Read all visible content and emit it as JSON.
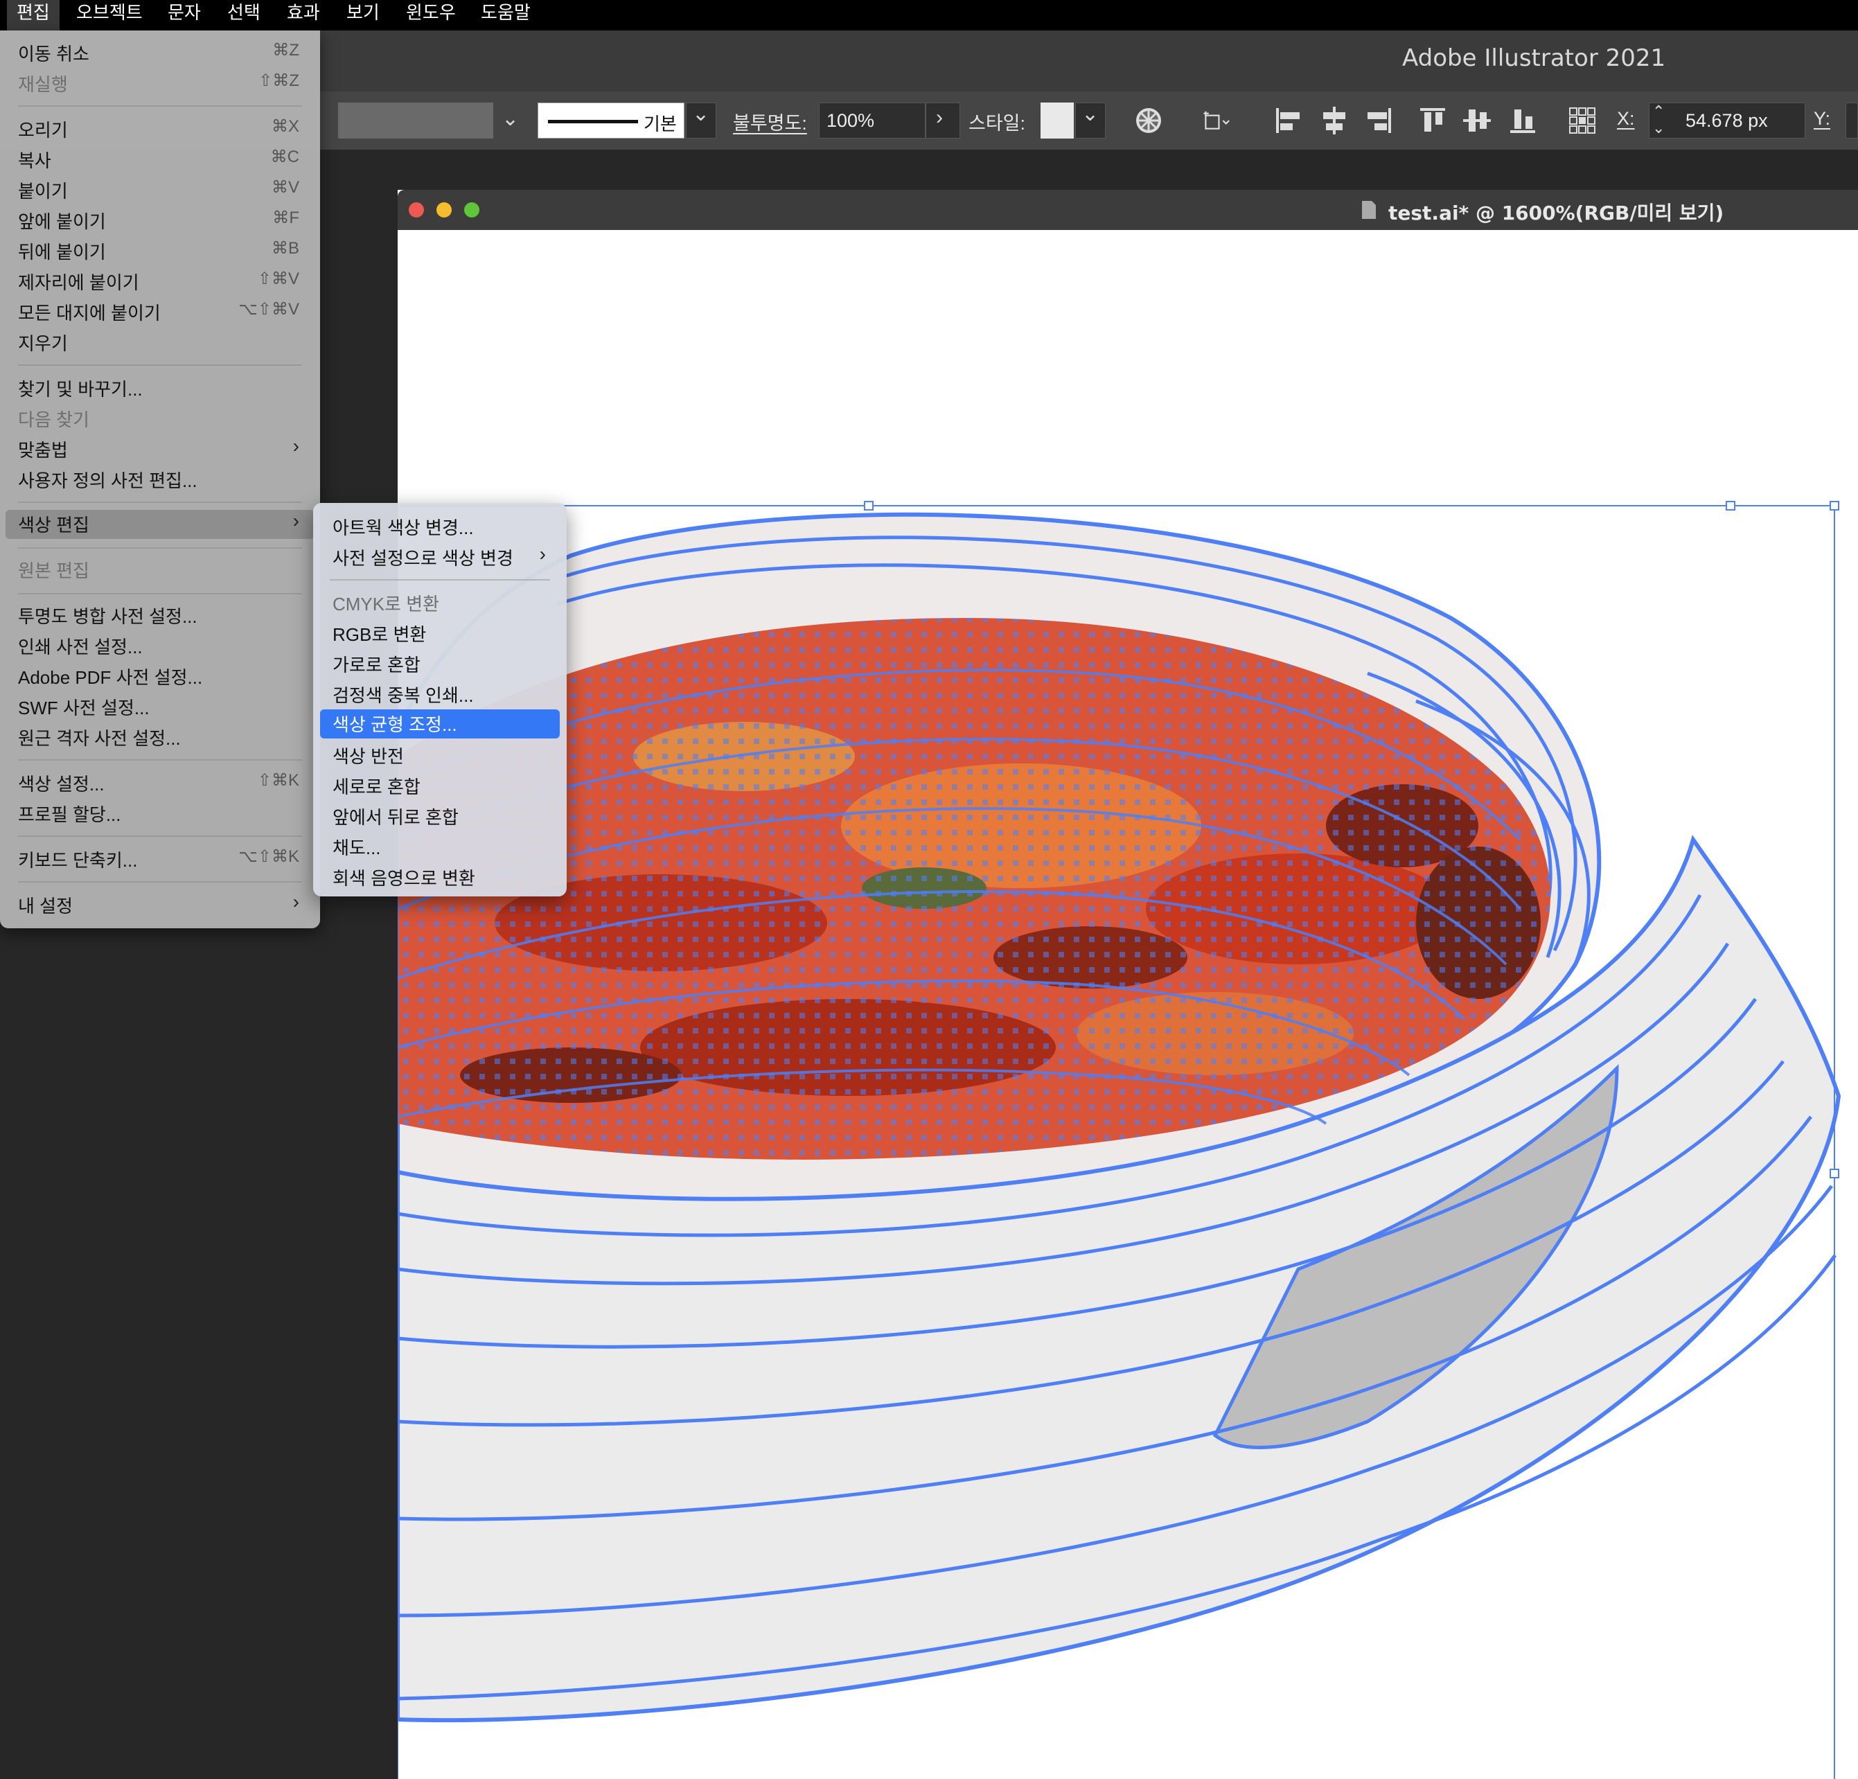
{
  "menubar": {
    "items": [
      "편집",
      "오브젝트",
      "문자",
      "선택",
      "효과",
      "보기",
      "윈도우",
      "도움말"
    ]
  },
  "app": {
    "title": "Adobe Illustrator 2021"
  },
  "control_bar": {
    "stroke_profile": "기본",
    "opacity_label": "불투명도:",
    "opacity_value": "100%",
    "style_label": "스타일:",
    "x_label": "X:",
    "x_value": "54.678 px",
    "y_label": "Y:"
  },
  "document": {
    "title": "test.ai* @ 1600%(RGB/미리 보기)"
  },
  "edit_menu": {
    "items": [
      {
        "label": "이동 취소",
        "shortcut": "⌘Z",
        "enabled": true
      },
      {
        "label": "재실행",
        "shortcut": "⇧⌘Z",
        "enabled": false
      },
      {
        "label": "오리기",
        "shortcut": "⌘X",
        "enabled": true
      },
      {
        "label": "복사",
        "shortcut": "⌘C",
        "enabled": true
      },
      {
        "label": "붙이기",
        "shortcut": "⌘V",
        "enabled": true
      },
      {
        "label": "앞에 붙이기",
        "shortcut": "⌘F",
        "enabled": true
      },
      {
        "label": "뒤에 붙이기",
        "shortcut": "⌘B",
        "enabled": true
      },
      {
        "label": "제자리에 붙이기",
        "shortcut": "⇧⌘V",
        "enabled": true
      },
      {
        "label": "모든 대지에 붙이기",
        "shortcut": "⌥⇧⌘V",
        "enabled": true
      },
      {
        "label": "지우기",
        "shortcut": "",
        "enabled": true
      },
      {
        "label": "찾기 및 바꾸기...",
        "shortcut": "",
        "enabled": true
      },
      {
        "label": "다음 찾기",
        "shortcut": "",
        "enabled": false
      },
      {
        "label": "맞춤법",
        "shortcut": "",
        "enabled": true
      },
      {
        "label": "사용자 정의 사전 편집...",
        "shortcut": "",
        "enabled": true
      },
      {
        "label": "색상 편집",
        "shortcut": "",
        "enabled": true
      },
      {
        "label": "원본 편집",
        "shortcut": "",
        "enabled": false
      },
      {
        "label": "투명도 병합 사전 설정...",
        "shortcut": "",
        "enabled": true
      },
      {
        "label": "인쇄 사전 설정...",
        "shortcut": "",
        "enabled": true
      },
      {
        "label": "Adobe PDF 사전 설정...",
        "shortcut": "",
        "enabled": true
      },
      {
        "label": "SWF 사전 설정...",
        "shortcut": "",
        "enabled": true
      },
      {
        "label": "원근 격자 사전 설정...",
        "shortcut": "",
        "enabled": true
      },
      {
        "label": "색상 설정...",
        "shortcut": "⇧⌘K",
        "enabled": true
      },
      {
        "label": "프로필 할당...",
        "shortcut": "",
        "enabled": true
      },
      {
        "label": "키보드 단축키...",
        "shortcut": "⌥⇧⌘K",
        "enabled": true
      },
      {
        "label": "내 설정",
        "shortcut": "",
        "enabled": true
      }
    ]
  },
  "color_submenu": {
    "items": [
      {
        "label": "아트웍 색상 변경...",
        "enabled": true
      },
      {
        "label": "사전 설정으로 색상 변경",
        "enabled": true
      },
      {
        "label": "CMYK로 변환",
        "enabled": false
      },
      {
        "label": "RGB로 변환",
        "enabled": true
      },
      {
        "label": "가로로 혼합",
        "enabled": true
      },
      {
        "label": "검정색 중복 인쇄...",
        "enabled": true
      },
      {
        "label": "색상 균형 조정...",
        "enabled": true,
        "selected": true
      },
      {
        "label": "색상 반전",
        "enabled": true
      },
      {
        "label": "세로로 혼합",
        "enabled": true
      },
      {
        "label": "앞에서 뒤로 혼합",
        "enabled": true
      },
      {
        "label": "채도...",
        "enabled": true
      },
      {
        "label": "회색 음영으로 변환",
        "enabled": true
      }
    ]
  },
  "colors": {
    "selection_blue": "#4f7ff5",
    "menu_highlight": "#3478f6",
    "artwork_reds": [
      "#d8442c",
      "#b8321e",
      "#e77a3a",
      "#7a2418",
      "#e09a4a",
      "#5a6a3a"
    ]
  }
}
